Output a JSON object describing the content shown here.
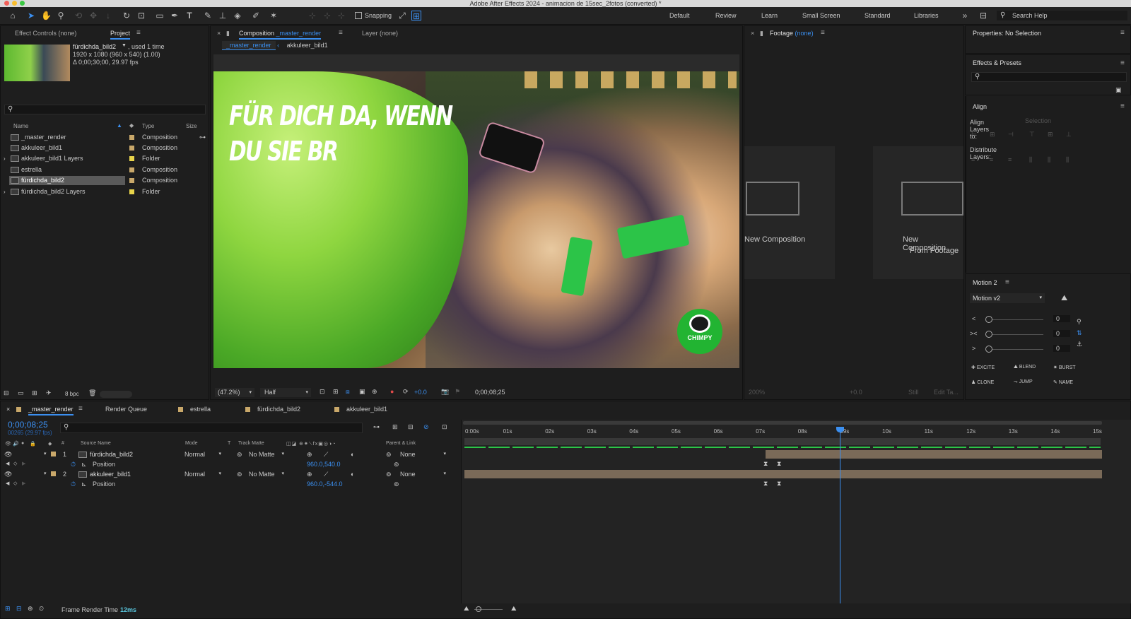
{
  "window": {
    "title": "Adobe After Effects 2024 - animacion de 15sec_2fotos (converted) *"
  },
  "toolbar": {
    "snapping_label": "Snapping",
    "workspaces": [
      "Default",
      "Review",
      "Learn",
      "Small Screen",
      "Standard",
      "Libraries"
    ],
    "search_help": "Search Help"
  },
  "project_panel": {
    "tabs": [
      "Effect Controls (none)",
      "Project"
    ],
    "selected": {
      "name": "fürdichda_bild2",
      "used": ", used 1 time",
      "dims": "1920 x 1080  (960 x 540) (1.00)",
      "duration": "Δ 0;00;30;00, 29.97 fps"
    },
    "columns": [
      "Name",
      "Type",
      "Size"
    ],
    "items": [
      {
        "name": "_master_render",
        "type": "Composition"
      },
      {
        "name": "akkuleer_bild1",
        "type": "Composition"
      },
      {
        "name": "akkuleer_bild1 Layers",
        "type": "Folder"
      },
      {
        "name": "estrella",
        "type": "Composition"
      },
      {
        "name": "fürdichda_bild2",
        "type": "Composition"
      },
      {
        "name": "fürdichda_bild2 Layers",
        "type": "Folder"
      }
    ],
    "bpc": "8 bpc"
  },
  "comp_panel": {
    "tab_prefix": "Composition",
    "tab_name": "_master_render",
    "layer_tab": "Layer (none)",
    "breadcrumbs": [
      "_master_render",
      "akkuleer_bild1"
    ],
    "headline_line1": "FÜR DICH DA, WENN",
    "headline_line2": "DU SIE BR",
    "logo_text": "CHIMPY",
    "zoom": "(47.2%)",
    "resolution": "Half",
    "exposure": "+0.0",
    "timecode": "0;00;08;25"
  },
  "footage_panel": {
    "tab_prefix": "Footage",
    "tab_name": "(none)",
    "new_comp": "New Composition",
    "new_comp_footage_1": "New Composition",
    "new_comp_footage_2": "From Footage",
    "zoom": "200%",
    "exposure": "+0.0",
    "still": "Still",
    "edit": "Edit Ta..."
  },
  "right_panels": {
    "properties": "Properties: No Selection",
    "effects": "Effects & Presets",
    "align": "Align",
    "align_to": "Align Layers to:",
    "align_select": "Selection",
    "distribute": "Distribute Layers:",
    "motion": "Motion 2",
    "motion_version": "Motion v2",
    "sliders": [
      {
        "label": "<",
        "value": "0"
      },
      {
        "label": "><",
        "value": "0"
      },
      {
        "label": ">",
        "value": "0"
      }
    ],
    "buttons": [
      "EXCITE",
      "BLEND",
      "BURST",
      "CLONE",
      "JUMP",
      "NAME"
    ]
  },
  "timeline": {
    "tabs": [
      "_master_render",
      "Render Queue",
      "estrella",
      "fürdichda_bild2",
      "akkuleer_bild1"
    ],
    "timecode": "0;00;08;25",
    "frames": "00265 (29.97 fps)",
    "columns": [
      "Source Name",
      "Mode",
      "T",
      "Track Matte",
      "Parent & Link"
    ],
    "layers": [
      {
        "num": "1",
        "name": "fürdichda_bild2",
        "mode": "Normal",
        "matte": "No Matte",
        "parent": "None",
        "prop": "Position",
        "value": "960.0,540.0"
      },
      {
        "num": "2",
        "name": "akkuleer_bild1",
        "mode": "Normal",
        "matte": "No Matte",
        "parent": "None",
        "prop": "Position",
        "value": "960.0,-544.0"
      }
    ],
    "ruler": [
      "0:00s",
      "01s",
      "02s",
      "03s",
      "04s",
      "05s",
      "06s",
      "07s",
      "08s",
      "09s",
      "10s",
      "11s",
      "12s",
      "13s",
      "14s",
      "15s"
    ],
    "current_time_sec": 8.9,
    "frame_render_label": "Frame Render Time",
    "frame_render_value": "12ms"
  }
}
